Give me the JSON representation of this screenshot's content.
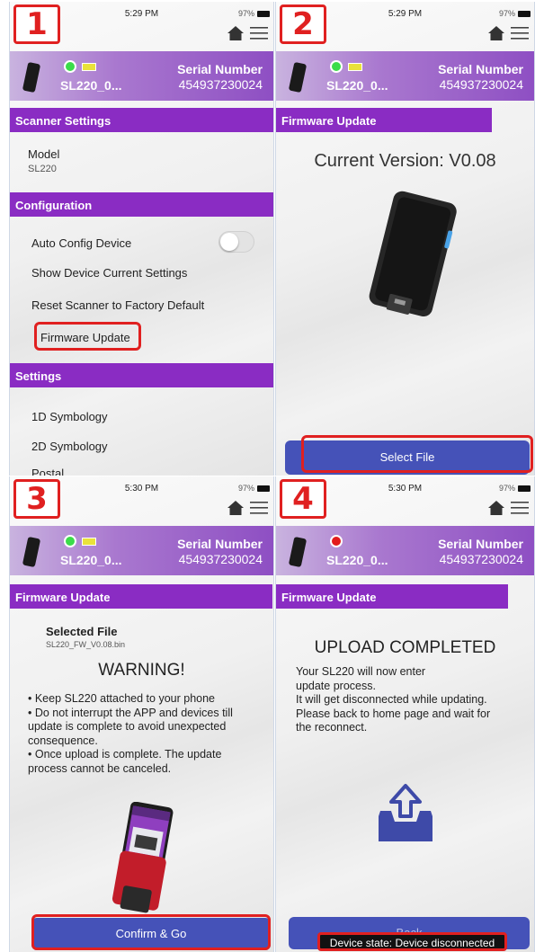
{
  "status": {
    "time1": "5:29 PM",
    "time2": "5:29 PM",
    "time3": "5:30 PM",
    "time4": "5:30 PM",
    "battery": "97%"
  },
  "steps": [
    "1",
    "2",
    "3",
    "4"
  ],
  "device": {
    "name": "SL220_0...",
    "serial_label": "Serial Number",
    "serial_value": "454937230024"
  },
  "screen1": {
    "scanner_settings": "Scanner Settings",
    "model_label": "Model",
    "model_value": "SL220",
    "configuration": "Configuration",
    "auto_config": "Auto Config Device",
    "show_settings": "Show Device Current Settings",
    "reset_factory": "Reset Scanner to Factory Default",
    "firmware_update": "Firmware Update",
    "settings": "Settings",
    "symbology_1d": "1D Symbology",
    "symbology_2d": "2D Symbology",
    "postal": "Postal"
  },
  "screen2": {
    "section": "Firmware Update",
    "current_version": "Current Version: V0.08",
    "select_file": "Select File"
  },
  "screen3": {
    "section": "Firmware Update",
    "selected_file_label": "Selected File",
    "selected_file_name": "SL220_FW_V0.08.bin",
    "warning_title": "WARNING!",
    "bullets": [
      "• Keep SL220 attached to your phone",
      "• Do not interrupt the APP and devices till update is complete to avoid unexpected consequence.",
      "• Once upload is complete. The update process cannot be canceled."
    ],
    "confirm": "Confirm & Go"
  },
  "screen4": {
    "section": "Firmware Update",
    "title": "UPLOAD COMPLETED",
    "lines": [
      "Your SL220 will now enter",
      "update process.",
      "It will get disconnected while updating.",
      "Please back to home page and wait for",
      "the reconnect."
    ],
    "back_label": "Back",
    "toast": "Device state: Device disconnected"
  },
  "colors": {
    "accent_purple": "#8a2cc3",
    "button_blue": "#4552b8",
    "highlight_red": "#e02020"
  },
  "icons": [
    "home-icon",
    "menu-icon",
    "upload-tray-icon"
  ]
}
